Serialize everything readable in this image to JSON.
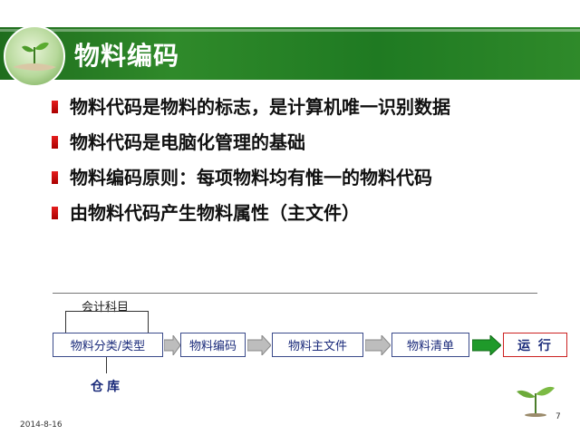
{
  "slide": {
    "title": "物料编码",
    "bullets": [
      "物料代码是物料的标志，是计算机唯一识别数据",
      "物料代码是电脑化管理的基础",
      "物料编码原则：每项物料均有惟一的物料代码",
      "由物料代码产生物料属性（主文件）"
    ],
    "flow": {
      "top_label": "会计科目",
      "boxes": [
        "物料分类/类型",
        "物料编码",
        "物料主文件",
        "物料清单",
        "运 行"
      ],
      "bottom_label": "仓库"
    },
    "footer": {
      "date": "2014-8-16",
      "page": "7"
    }
  },
  "colors": {
    "banner": "#2f8a2a",
    "bullet_mark": "#cc1111",
    "box_text": "#1a2a7a",
    "final_arrow": "#1f9a2a",
    "run_box_border": "#cc2222"
  }
}
